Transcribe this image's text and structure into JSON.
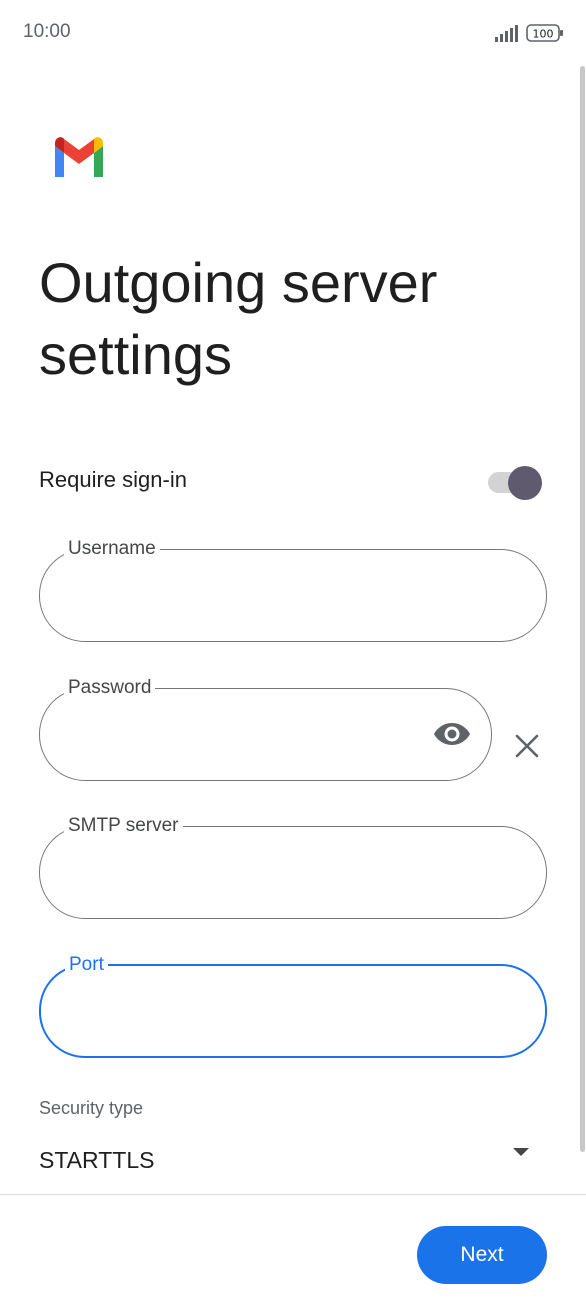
{
  "status_bar": {
    "time": "10:00",
    "battery": "100",
    "icons": [
      "signal-icon",
      "battery-icon"
    ]
  },
  "app": {
    "logo": "gmail-logo",
    "title": "Outgoing server settings"
  },
  "require_signin": {
    "label": "Require sign-in",
    "enabled": true
  },
  "fields": {
    "username": {
      "label": "Username",
      "value": ""
    },
    "password": {
      "label": "Password",
      "value": ""
    },
    "smtp_server": {
      "label": "SMTP server",
      "value": ""
    },
    "port": {
      "label": "Port",
      "value": ""
    }
  },
  "icons": {
    "password_visibility": "eye-icon",
    "password_clear": "close-icon",
    "security_dropdown": "dropdown-arrow-icon"
  },
  "security": {
    "label": "Security type",
    "selected": "STARTTLS"
  },
  "footer": {
    "next_label": "Next"
  },
  "colors": {
    "accent": "#1a73e8",
    "toggle_thumb": "#5f5a6e",
    "field_border": "#747775"
  }
}
